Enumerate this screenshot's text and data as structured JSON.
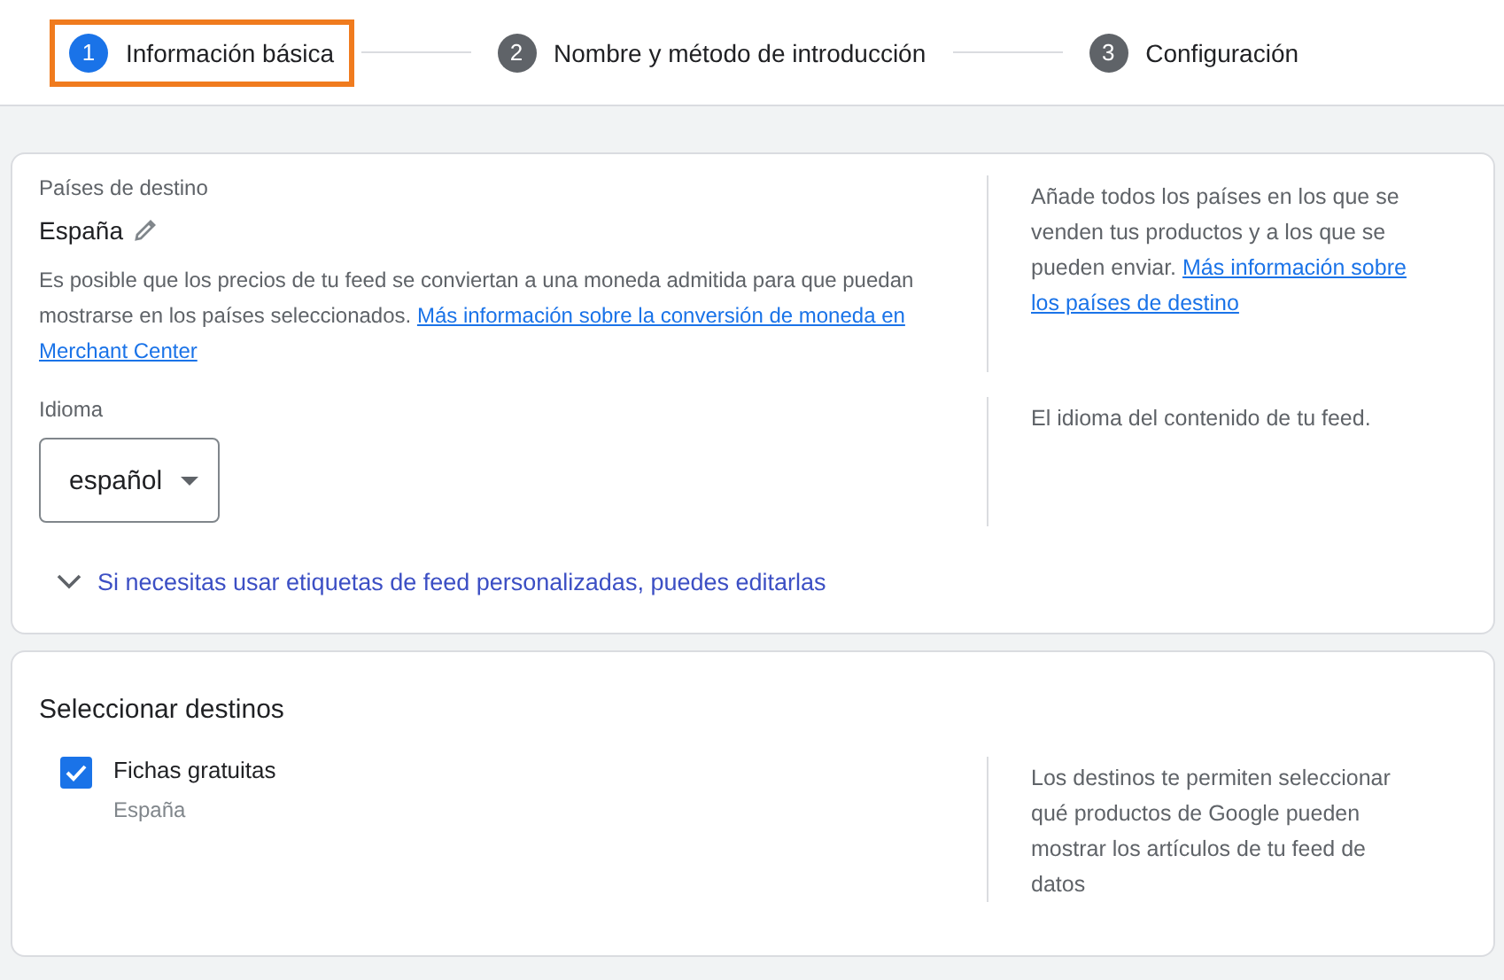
{
  "steps": [
    {
      "number": "1",
      "label": "Información básica",
      "selected": true,
      "highlighted": true
    },
    {
      "number": "2",
      "label": "Nombre y método de introducción",
      "selected": false,
      "highlighted": false
    },
    {
      "number": "3",
      "label": "Configuración",
      "selected": false,
      "highlighted": false
    }
  ],
  "basic_card": {
    "countries": {
      "label": "Países de destino",
      "value": "España",
      "note": "Es posible que los precios de tu feed se conviertan a una moneda admitida para que puedan mostrarse en los países seleccionados.",
      "note_link": [
        "Más información sobre la conversión de moneda en",
        "Merchant Center"
      ],
      "help": "Añade todos los países en los que se venden tus productos y a los que se pueden enviar.",
      "help_link": [
        "Más información sobre",
        "los países de destino"
      ]
    },
    "language": {
      "label": "Idioma",
      "value": "español",
      "help": "El idioma del contenido de tu feed."
    },
    "expander": {
      "label": "Si necesitas usar etiquetas de feed personalizadas, puedes editarlas",
      "expanded": false
    }
  },
  "destinations_card": {
    "title": "Seleccionar destinos",
    "items": [
      {
        "label": "Fichas gratuitas",
        "sublabel": "España",
        "checked": true
      }
    ],
    "help": "Los destinos te permiten seleccionar qué productos de Google pueden mostrar los artículos de tu feed de datos"
  }
}
